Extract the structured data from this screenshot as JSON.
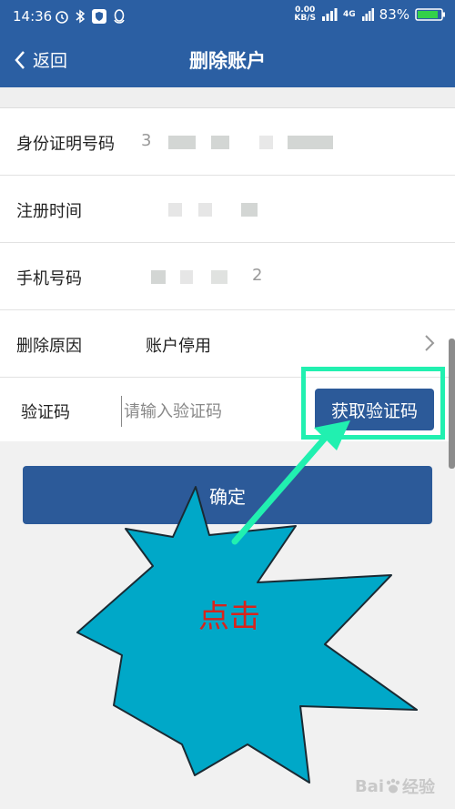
{
  "status_bar": {
    "time": "14:36",
    "net_speed": "0.00",
    "net_speed_unit": "KB/S",
    "network_type": "4G",
    "battery": "83%"
  },
  "nav": {
    "back_label": "返回",
    "title": "删除账户"
  },
  "form": {
    "id_label": "身份证明号码",
    "id_value_prefix": "3",
    "register_time_label": "注册时间",
    "phone_label": "手机号码",
    "phone_value_fragment": "2",
    "reason_label": "删除原因",
    "reason_value": "账户停用",
    "code_label": "验证码",
    "code_placeholder": "请输入验证码",
    "get_code_label": "获取验证码"
  },
  "confirm_label": "确定",
  "annotation": {
    "burst_text": "点击",
    "highlight_color": "#21f0b0",
    "burst_color": "#00a8c8",
    "text_color": "#d8241c"
  },
  "watermark": "经验"
}
